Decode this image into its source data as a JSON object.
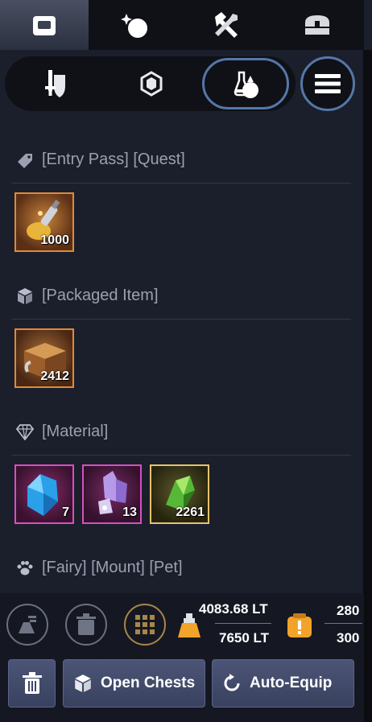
{
  "top_tabs": [
    {
      "icon": "bag-icon"
    },
    {
      "icon": "orb-sparkle-icon"
    },
    {
      "icon": "tools-icon"
    },
    {
      "icon": "chest-icon"
    }
  ],
  "filters": [
    {
      "icon": "sword-shield-icon"
    },
    {
      "icon": "gem-icon"
    },
    {
      "icon": "potion-bag-icon"
    }
  ],
  "sections": {
    "entry": {
      "label": "[Entry Pass] [Quest]",
      "items": [
        {
          "qty": "1000"
        }
      ]
    },
    "packaged": {
      "label": "[Packaged Item]",
      "items": [
        {
          "qty": "2412"
        }
      ]
    },
    "material": {
      "label": "[Material]",
      "items": [
        {
          "qty": "7"
        },
        {
          "qty": "13"
        },
        {
          "qty": "2261"
        }
      ]
    },
    "pets": {
      "label": "[Fairy] [Mount] [Pet]"
    }
  },
  "weight": {
    "current": "4083.68 LT",
    "max": "7650 LT"
  },
  "slots": {
    "current": "280",
    "max": "300"
  },
  "buttons": {
    "open_chests": "Open Chests",
    "auto_equip": "Auto-Equip"
  },
  "colors": {
    "accent": "#5577a8",
    "rare_border": "#e08a3a",
    "epic_border": "#d84fc0",
    "legend_border": "#e7c46a"
  }
}
